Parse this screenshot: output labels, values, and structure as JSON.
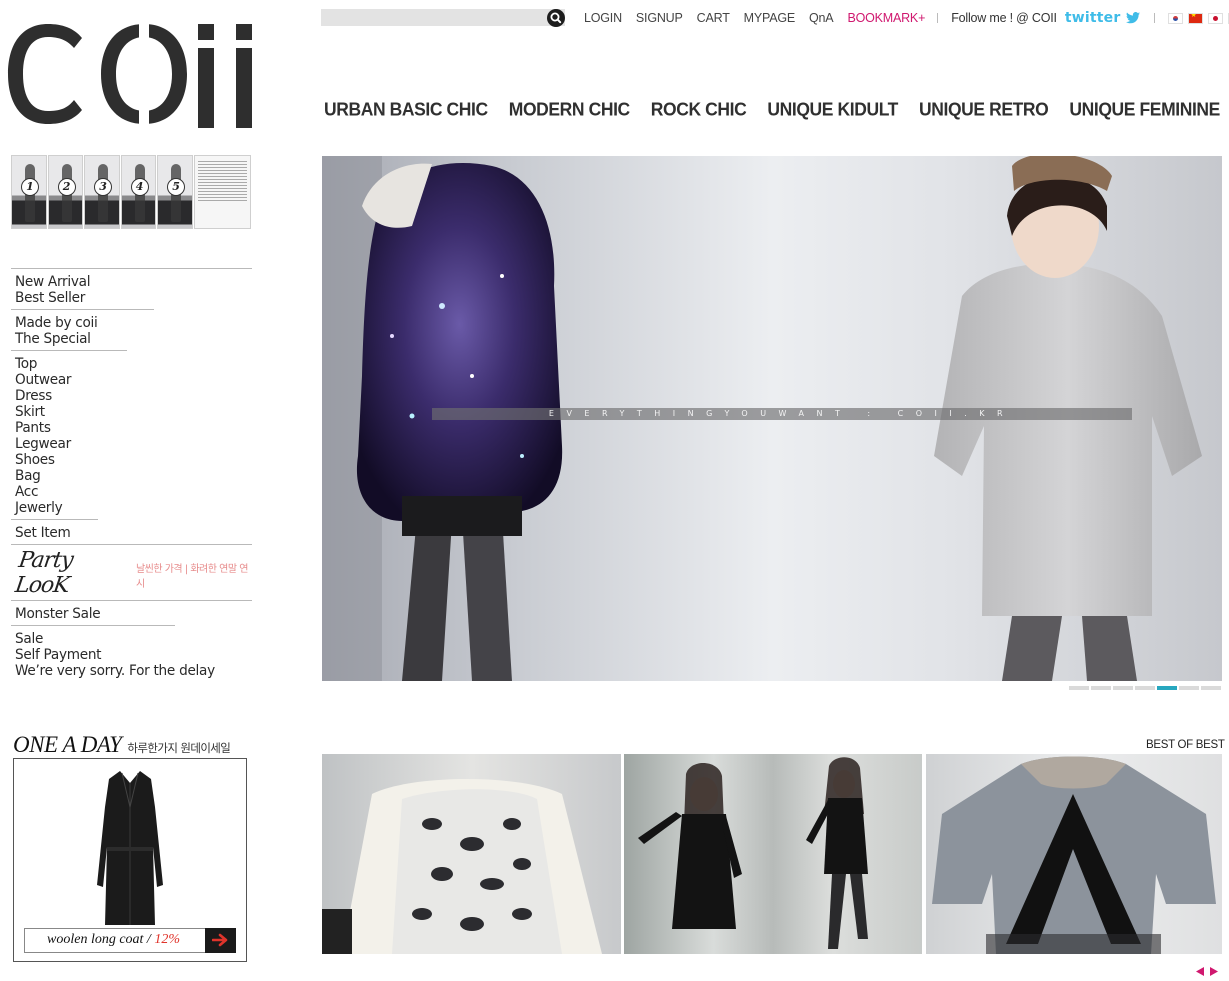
{
  "brand": {
    "logo": "COii"
  },
  "search": {
    "placeholder": ""
  },
  "topnav": {
    "login": "LOGIN",
    "signup": "SIGNUP",
    "cart": "CART",
    "mypage": "MYPAGE",
    "qna": "QnA",
    "bookmark": "BOOKMARK+",
    "follow": "Follow me ! @ COII",
    "twitter": "twitter",
    "languages": [
      "Korean",
      "Chinese",
      "Japanese",
      "English"
    ]
  },
  "mainnav": [
    "URBAN BASIC CHIC",
    "MODERN CHIC",
    "ROCK CHIC",
    "UNIQUE KIDULT",
    "UNIQUE RETRO",
    "UNIQUE FEMININE"
  ],
  "thumbs": [
    "1",
    "2",
    "3",
    "4",
    "5"
  ],
  "menu": {
    "group1": [
      "New Arrival",
      "Best Seller"
    ],
    "group2": [
      "Made by coii",
      "The Special"
    ],
    "group3": [
      "Top",
      "Outwear",
      "Dress",
      "Skirt",
      "Pants",
      "Legwear",
      "Shoes",
      "Bag",
      "Acc",
      "Jewerly"
    ],
    "group4": [
      "Set Item"
    ],
    "party_title": "Party LooK",
    "party_sub": "날씬한 가격 | 화려한 연말 연시",
    "group5": [
      "Monster Sale"
    ],
    "group6": [
      "Sale",
      "Self Payment",
      "We’re very sorry. For the delay"
    ]
  },
  "oneaday": {
    "title": "ONE A DAY",
    "subtitle": "하루한가지 원데이세일",
    "product": "woolen long coat /",
    "discount": "12%"
  },
  "hero": {
    "tagline": "EVERYTHINGYOUWANT : COII.KR",
    "slides": 7,
    "active_slide": 6
  },
  "best": {
    "title": "BEST OF BEST"
  },
  "colors": {
    "accent": "#d0186f",
    "slider_active": "#27a7bf",
    "twitter": "#3fbce8",
    "discount": "#e0342b"
  }
}
